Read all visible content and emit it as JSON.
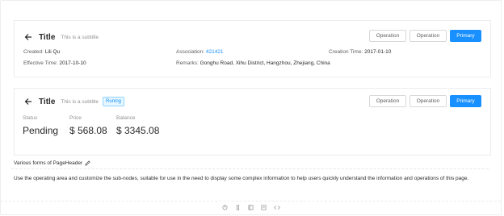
{
  "header1": {
    "title": "Title",
    "subtitle": "This is a subtitle",
    "buttons": {
      "op1": "Operation",
      "op2": "Operation",
      "primary": "Primary"
    },
    "descriptions": [
      {
        "label": "Created:",
        "value": "Lili Qu"
      },
      {
        "label": "Association:",
        "value": "421421"
      },
      {
        "label": "Creation Time:",
        "value": "2017-01-10"
      },
      {
        "label": "Effective Time:",
        "value": "2017-10-10"
      },
      {
        "label": "Remarks:",
        "value": "Gonghu Road, Xihu District, Hangzhou, Zhejiang, China"
      }
    ]
  },
  "header2": {
    "title": "Title",
    "subtitle": "This is a subtitle",
    "tag": "Runing",
    "buttons": {
      "op1": "Operation",
      "op2": "Operation",
      "primary": "Primary"
    },
    "stats": [
      {
        "label": "Status",
        "value": "Pending"
      },
      {
        "label": "Price",
        "value": "$ 568.08"
      },
      {
        "label": "Balance",
        "value": "$ 3345.08"
      }
    ]
  },
  "demo": {
    "title": "Various forms of PageHeader",
    "description": "Use the operating area and customize the sub-nodes, suitable for use in the need to display some complex information to help users quickly understand the information and operations of this page."
  },
  "colors": {
    "primary": "#1890ff",
    "border": "#ebedf0"
  },
  "icons": [
    "arrow-left-icon",
    "edit-icon",
    "expand-icon",
    "snippets-icon",
    "codepen-icon",
    "codesandbox-icon",
    "code-icon"
  ]
}
